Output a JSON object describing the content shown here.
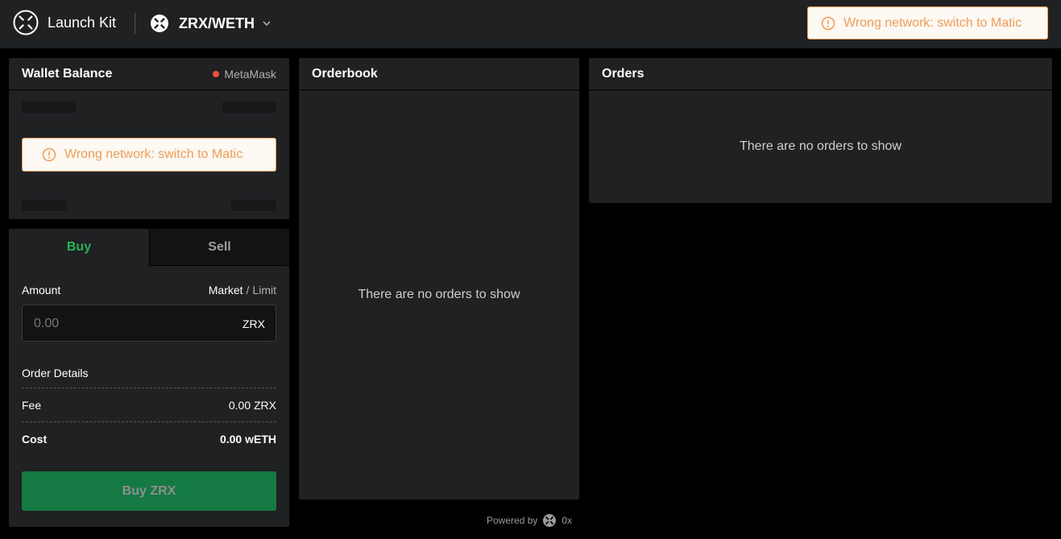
{
  "header": {
    "brand": "Launch Kit",
    "market": "ZRX/WETH",
    "network_alert": "Wrong network: switch to Matic"
  },
  "wallet": {
    "title": "Wallet Balance",
    "provider": "MetaMask",
    "provider_status_color": "#e9503f",
    "network_alert": "Wrong network: switch to Matic"
  },
  "trade": {
    "tabs": {
      "buy": "Buy",
      "sell": "Sell"
    },
    "active_tab": "Buy",
    "amount_label": "Amount",
    "order_type": {
      "market": "Market",
      "separator": "/",
      "limit": "Limit"
    },
    "amount_placeholder": "0.00",
    "amount_token": "ZRX",
    "order_details_title": "Order Details",
    "fee_label": "Fee",
    "fee_value": "0.00 ZRX",
    "cost_label": "Cost",
    "cost_value": "0.00 wETH",
    "submit_label": "Buy ZRX"
  },
  "orderbook": {
    "title": "Orderbook",
    "empty_message": "There are no orders to show"
  },
  "orders": {
    "title": "Orders",
    "empty_message": "There are no orders to show"
  },
  "footer": {
    "powered_by": "Powered by",
    "powered_brand": "0x"
  },
  "colors": {
    "buy_accent": "#29b359",
    "buy_button": "#157944",
    "warning": "#f19c57",
    "panel_bg": "#202123"
  },
  "icons": {
    "logo": "0x-logo-icon",
    "market": "0x-token-icon",
    "alert": "exclamation-circle-icon",
    "dropdown": "chevron-down-icon"
  }
}
